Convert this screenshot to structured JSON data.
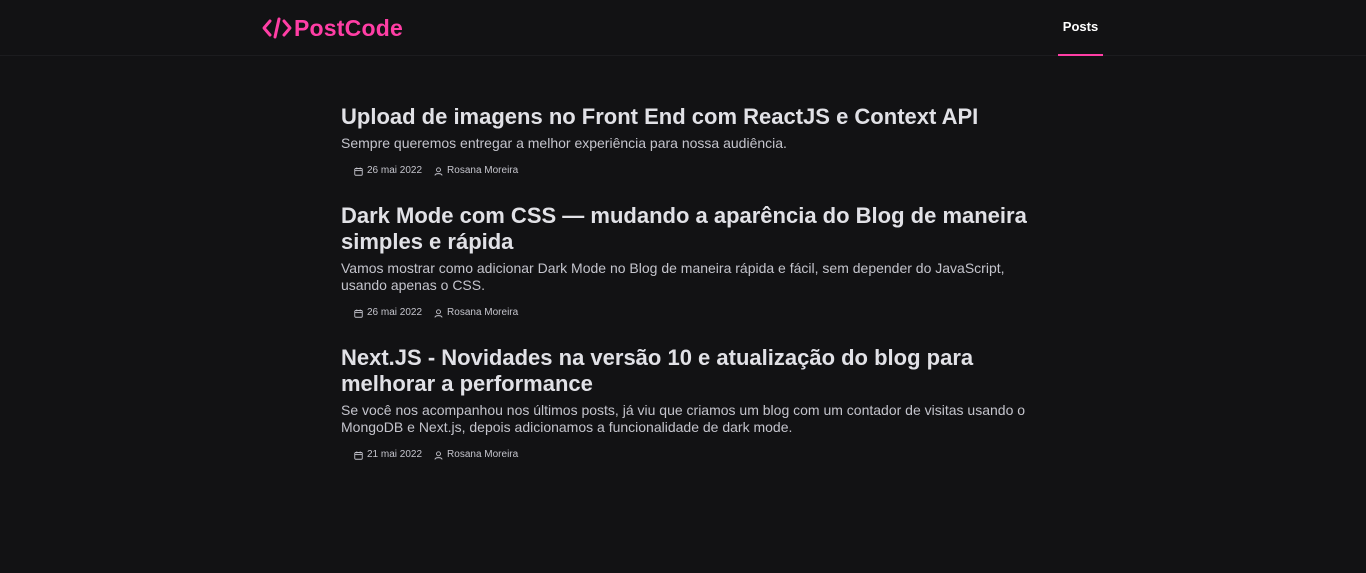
{
  "header": {
    "logo_text": "PostCode",
    "logo_icon": "code-brackets-icon",
    "accent_color": "#ff3ea5",
    "nav": [
      {
        "label": "Posts",
        "active": true
      }
    ]
  },
  "posts": [
    {
      "title": "Upload de imagens no Front End com ReactJS e Context API",
      "excerpt": "Sempre queremos entregar a melhor experiência para nossa audiência.",
      "date": "26 mai 2022",
      "author": "Rosana Moreira"
    },
    {
      "title": "Dark Mode com CSS — mudando a aparência do Blog de maneira simples e rápida",
      "excerpt": "Vamos mostrar como adicionar Dark Mode no Blog de maneira rápida e fácil, sem depender do JavaScript, usando apenas o CSS.",
      "date": "26 mai 2022",
      "author": "Rosana Moreira"
    },
    {
      "title": "Next.JS - Novidades na versão 10 e atualização do blog para melhorar a performance",
      "excerpt": "Se você nos acompanhou nos últimos posts, já viu que criamos um blog com um contador de visitas usando o MongoDB e Next.js, depois adicionamos a funcionalidade de dark mode.",
      "date": "21 mai 2022",
      "author": "Rosana Moreira"
    }
  ],
  "icons": {
    "date": "calendar-icon",
    "author": "user-icon"
  }
}
